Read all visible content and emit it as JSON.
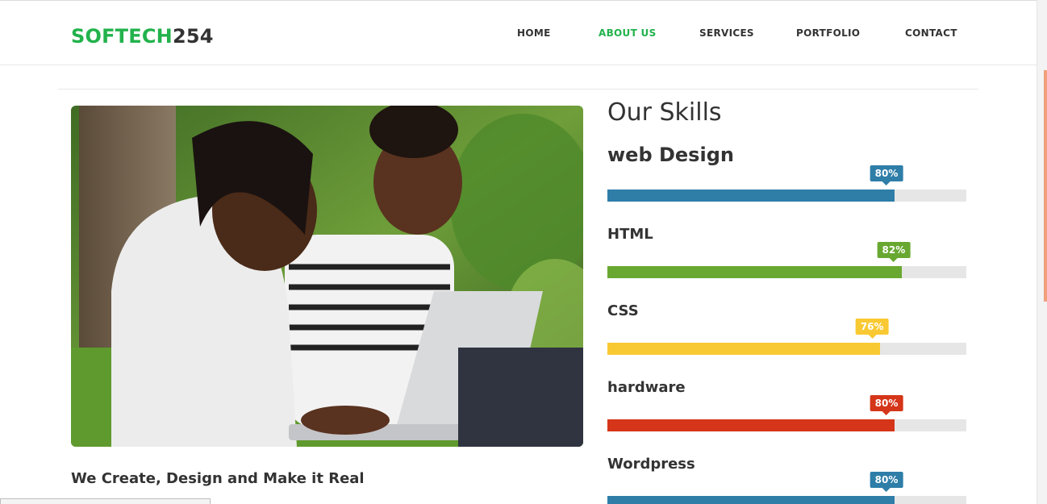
{
  "brand": {
    "part1": "SOFTECH",
    "part2": "254",
    "color1": "#22b24c",
    "color2": "#333333"
  },
  "nav": {
    "items": [
      {
        "label": "HOME",
        "active": false
      },
      {
        "label": "ABOUT US",
        "active": true
      },
      {
        "label": "SERVICES",
        "active": false
      },
      {
        "label": "PORTFOLIO",
        "active": false
      },
      {
        "label": "CONTACT",
        "active": false
      }
    ],
    "active_color": "#22b24c"
  },
  "main": {
    "tagline": "We Create, Design and Make it Real",
    "photo_subject": "two students laughing while using a laptop outdoors"
  },
  "skills": {
    "title": "Our Skills",
    "items": [
      {
        "name": "web Design",
        "percent": 80,
        "label": "80%",
        "color": "#2e7ea8"
      },
      {
        "name": "HTML",
        "percent": 82,
        "label": "82%",
        "color": "#68a830"
      },
      {
        "name": "CSS",
        "percent": 76,
        "label": "76%",
        "color": "#f9c933"
      },
      {
        "name": "hardware",
        "percent": 80,
        "label": "80%",
        "color": "#d53518"
      },
      {
        "name": "Wordpress",
        "percent": 80,
        "label": "80%",
        "color": "#2e7ea8"
      }
    ]
  },
  "scrollbar": {
    "thumb_color": "#f0a07c"
  }
}
